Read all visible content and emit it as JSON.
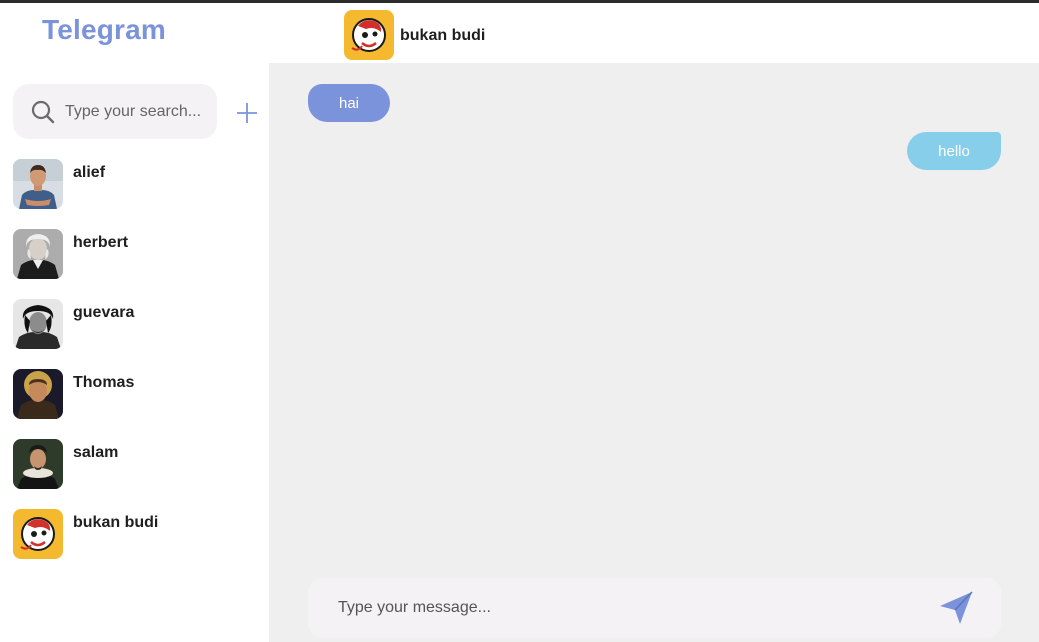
{
  "app": {
    "brand": "Telegram"
  },
  "sidebar": {
    "search": {
      "placeholder": "Type your search...",
      "value": ""
    },
    "contacts": [
      {
        "name": "alief",
        "avatar": "photo-man-blue-shirt"
      },
      {
        "name": "herbert",
        "avatar": "photo-old-man-bw"
      },
      {
        "name": "guevara",
        "avatar": "photo-che-bw"
      },
      {
        "name": "Thomas",
        "avatar": "painting-monk"
      },
      {
        "name": "salam",
        "avatar": "painting-ruff-collar"
      },
      {
        "name": "bukan budi",
        "avatar": "logo-mascot-yellow"
      }
    ]
  },
  "chat": {
    "contact_name": "bukan budi",
    "messages": [
      {
        "direction": "incoming",
        "text": "hai"
      },
      {
        "direction": "outgoing",
        "text": "hello"
      }
    ],
    "composer": {
      "placeholder": "Type your message...",
      "value": ""
    }
  },
  "colors": {
    "accent": "#7b93db",
    "outgoing_bubble": "#87ceeb",
    "chat_background": "#efefef",
    "input_background": "#f4f2f4"
  }
}
